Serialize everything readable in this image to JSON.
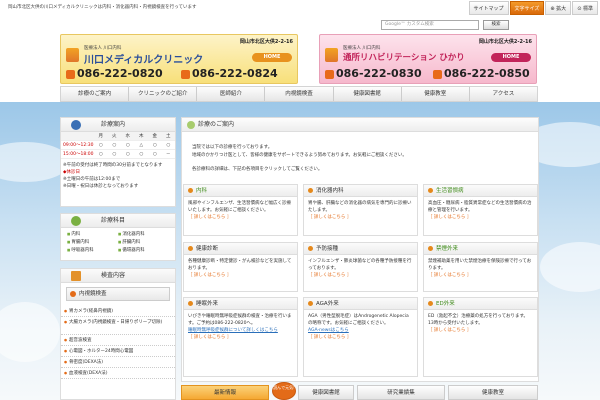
{
  "top": {
    "description": "岡山市北区大供の川口メディカルクリニックは内科・消化器内科・内視鏡検査を行っています",
    "links": {
      "sitemap": "サイトマップ",
      "font_size": "文字サイズ",
      "enlarge": "拡大",
      "standard": "標準"
    }
  },
  "search": {
    "placeholder": "Google™ カスタム検索",
    "button": "検索"
  },
  "clinics": [
    {
      "sub": "医療法人 川口内科",
      "name": "川口メディカルクリニック",
      "address": "岡山市北区大供2-2-16",
      "home": "HOME",
      "tel1": "086-222-0820",
      "tel2": "086-222-0824"
    },
    {
      "sub": "医療法人 川口内科",
      "name": "通所リハビリテーション ひかり",
      "address": "岡山市北区大供2-2-16",
      "home": "HOME",
      "tel1": "086-222-0830",
      "tel2": "086-222-0850"
    }
  ],
  "nav": [
    "診療のご案内",
    "クリニックのご紹介",
    "医師紹介",
    "内視鏡検査",
    "健康図書館",
    "健康教室",
    "アクセス"
  ],
  "sidebar": {
    "schedule": {
      "title": "診療案内",
      "days": [
        "月",
        "火",
        "水",
        "木",
        "金",
        "土"
      ],
      "rows": [
        {
          "time": "09:00～12:30",
          "marks": [
            "○",
            "○",
            "○",
            "△",
            "○",
            "○"
          ]
        },
        {
          "time": "15:00～18:00",
          "marks": [
            "○",
            "○",
            "○",
            "○",
            "○",
            "－"
          ]
        }
      ],
      "notes": [
        "※午前の受付は終了時間の30分前までとなります",
        "◆休診日",
        "※土曜日の午前は12:00まで",
        "※日曜・祝日は休診となっております"
      ]
    },
    "departments": {
      "title": "診療科目",
      "items": [
        "内科",
        "消化器内科",
        "胃腸内科",
        "肝臓内科",
        "呼吸器内科",
        "循環器内科"
      ]
    },
    "exams": {
      "title": "検査内容",
      "sub": "内視鏡検査",
      "items": [
        "胃カメラ(経鼻内視鏡)",
        "大腸カメラ(内視鏡検査・日帰りポリープ切除)",
        "超音波検査",
        "心電図・ホルター24時間心電図",
        "骨密度(DEXA法)",
        "血液検査(DEXA法)"
      ]
    }
  },
  "main": {
    "title": "診療のご案内",
    "intro": [
      "当院では以下の診療を行っております。",
      "地域のかかりつけ医として、皆様の健康をサポートできるよう努めております。お気軽にご相談ください。",
      "各診療科の詳細は、下記の各項目をクリックしてご覧ください。"
    ],
    "cards": [
      {
        "title": "内科",
        "green": true,
        "body": "風邪やインフルエンザ、生活習慣病など幅広く診療いたします。お気軽にご相談ください。",
        "more": "［ 詳しくはこちら ］"
      },
      {
        "title": "消化器内科",
        "green": false,
        "body": "胃や腸、肝臓などの消化器の病気を専門的に診療いたします。",
        "more": "［ 詳しくはこちら ］"
      },
      {
        "title": "生活習慣病",
        "green": true,
        "body": "高血圧・糖尿病・脂質異常症などの生活習慣病の治療と管理を行います。",
        "more": "［ 詳しくはこちら ］"
      },
      {
        "title": "健康診断",
        "green": false,
        "body": "各種健康診断・特定健診・がん検診などを実施しております。",
        "more": "［ 詳しくはこちら ］"
      },
      {
        "title": "予防接種",
        "green": false,
        "body": "インフルエンザ・肺炎球菌などの各種予防接種を行っております。",
        "more": "［ 詳しくはこちら ］"
      },
      {
        "title": "禁煙外来",
        "green": true,
        "body": "禁煙補助薬を用いた禁煙治療を保険診療で行っております。",
        "more": "［ 詳しくはこちら ］"
      },
      {
        "title": "睡眠外来",
        "green": false,
        "body": "いびきや睡眠時無呼吸症候群の検査・治療を行います。ご予約は086-222-0820へ。",
        "link": "睡眠時無呼吸症候群について詳しくはこちら",
        "more": "［ 詳しくはこちら ］"
      },
      {
        "title": "AGA外来",
        "green": false,
        "body": "AGA（男性型脱毛症）はAndrogenetic Alopeciaの略称です。お気軽にご相談ください。",
        "link": "AGA-newsはこちら",
        "more": "［ 詳しくはこちら ］"
      },
      {
        "title": "ED外来",
        "green": true,
        "body": "ED（勃起不全）治療薬の処方を行っております。13時から受付いたします。",
        "more": "［ 詳しくはこちら ］"
      }
    ]
  },
  "bottom_tabs": [
    "最新情報",
    "読んで元気!",
    "健康図書館",
    "研究業績集",
    "健康教室"
  ],
  "colors": {
    "accent": "#e36b18",
    "green": "#3f8b1a",
    "link": "#2a6fba",
    "red": "#cc0000"
  }
}
